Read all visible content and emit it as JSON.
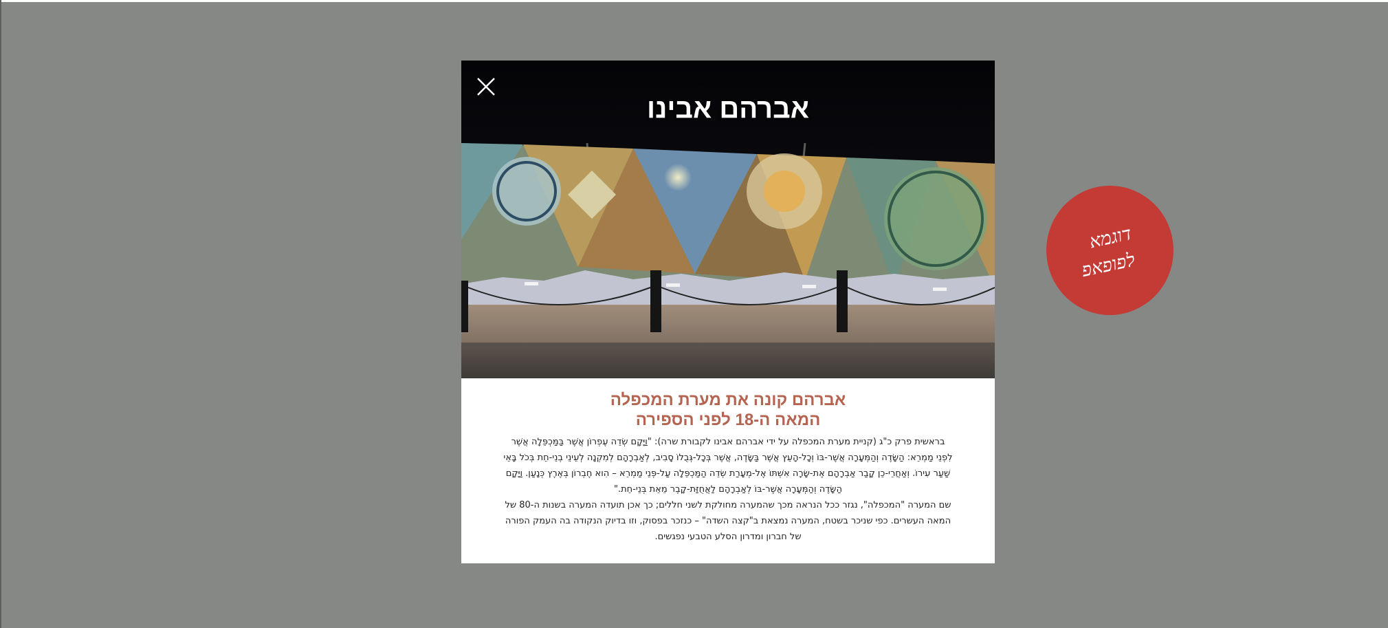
{
  "modal": {
    "title": "אברהם אבינו",
    "heading_line1": "אברהם קונה את מערת המכפלה",
    "heading_line2": "המאה ה-18 לפני הספירה",
    "paragraph1": "בראשית פרק כ\"ג (קניית מערת המכפלה על ידי אברהם אבינו לקבורת שרה): \"וַיָּקָם שְׂדֵה עֶפְרוֹן אֲשֶׁר בַּמַּכְפֵּלָה אֲשֶׁר לִפְנֵי מַמְרֵא: הַשָּׂדֶה וְהַמְּעָרָה אֲשֶׁר-בּוֹ וְכָל-הָעֵץ אֲשֶׁר בַּשָּׂדֶה, אֲשֶׁר בְּכָל-גְּבֻלוֹ סָבִיב, לְאַבְרָהָם לְמִקְנָה לְעֵינֵי בְנֵי-חֵת בְּכֹל בָּאֵי שַׁעַר עִירוֹ. וְאַחֲרֵי-כֵן קָבַר אַבְרָהָם אֶת-שָׂרָה אִשְׁתּוֹ אֶל-מְעָרַת שְׂדֵה הַמַּכְפֵּלָה עַל-פְּנֵי מַמְרֵא – הִוא חֶבְרוֹן בְּאֶרֶץ כְּנָעַן. וַיָּקָם הַשָּׂדֶה וְהַמְּעָרָה אֲשֶׁר-בּוֹ לְאַבְרָהָם לַאֲחֻזַּת-קָבֶר מֵאֵת בְּנֵי-חֵת.\"",
    "paragraph2": "שם המערה \"המכפלה\", נגזר ככל הנראה מכך שהמערה מחולקת לשני חללים; כך אכן תועדה המערה בשנות ה-80 של המאה העשרים. כפי שניכר בשטח, המערה נמצאת ב\"קצה השדה\" – כנזכר בפסוק, וזו בדיוק הנקודה בה העמק הפורה של חברון ומדרון הסלע הטבעי נפגשים.",
    "close_icon": "close-icon"
  },
  "badge": {
    "line1": "דוגמא",
    "line2": "לפופאפ"
  },
  "colors": {
    "backdrop": "#868885",
    "heading": "#b46450",
    "badge": "#c43b36"
  }
}
